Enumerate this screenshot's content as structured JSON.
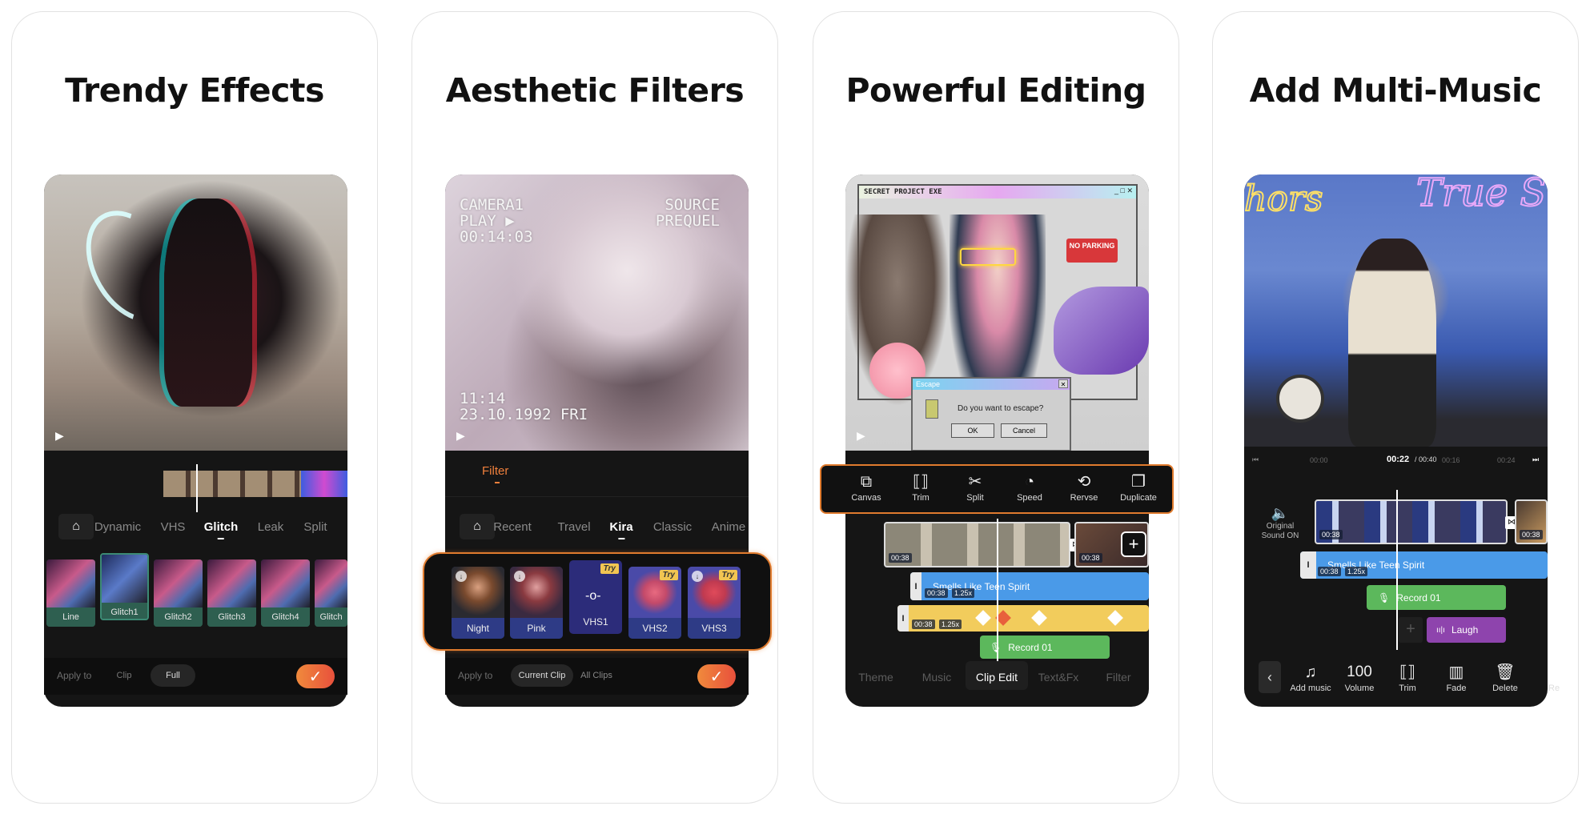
{
  "accent_color": "#f0803c",
  "panels": [
    {
      "title": "Trendy Effects",
      "timeline_tabs": [
        "Dynamic",
        "VHS",
        "Glitch",
        "Leak",
        "Split"
      ],
      "active_tab": "Glitch",
      "effects": [
        "Line",
        "Glitch1",
        "Glitch2",
        "Glitch3",
        "Glitch4",
        "Glitch"
      ],
      "selected_effect": "Glitch1",
      "apply_to_label": "Apply to",
      "apply_options": [
        "Clip",
        "Full"
      ],
      "apply_selected": "Full",
      "confirm_icon": "checkmark-icon"
    },
    {
      "title": "Aesthetic Filters",
      "overlay_top_left": [
        "CAMERA1",
        "PLAY ▶",
        "00:14:03"
      ],
      "overlay_top_right": [
        "SOURCE",
        "PREQUEL"
      ],
      "overlay_bottom_left": [
        "11:14",
        "23.10.1992 FRI"
      ],
      "section_label": "Filter",
      "filter_tabs": [
        "Recent",
        "Travel",
        "Kira",
        "Classic",
        "Anime"
      ],
      "active_tab": "Kira",
      "filters": [
        {
          "label": "Night",
          "badge": ""
        },
        {
          "label": "Pink",
          "badge": ""
        },
        {
          "label": "VHS1",
          "badge": "Try"
        },
        {
          "label": "VHS2",
          "badge": "Try"
        },
        {
          "label": "VHS3",
          "badge": "Try"
        }
      ],
      "selected_filter": "VHS1",
      "apply_to_label": "Apply to",
      "apply_options": [
        "Current Clip",
        "All Clips"
      ],
      "apply_selected": "Current Clip"
    },
    {
      "title": "Powerful Editing",
      "window_title": "SECRET PROJECT EXE",
      "sign_text": "NO PARKING",
      "dialog": {
        "title": "Escape",
        "message": "Do you want to escape?",
        "ok": "OK",
        "cancel": "Cancel"
      },
      "tools": [
        {
          "label": "Canvas",
          "icon": "canvas-icon"
        },
        {
          "label": "Trim",
          "icon": "trim-icon"
        },
        {
          "label": "Split",
          "icon": "scissors-icon"
        },
        {
          "label": "Speed",
          "icon": "speedometer-icon"
        },
        {
          "label": "Rervse",
          "icon": "reverse-icon"
        },
        {
          "label": "Duplicate",
          "icon": "duplicate-icon"
        }
      ],
      "clip_duration": "00:38",
      "music_track": {
        "name": "Smells Like Teen Spirit",
        "duration": "00:38",
        "speed": "1.25x"
      },
      "sticker_track": {
        "duration": "00:38",
        "speed": "1.25x"
      },
      "record_track": "Record 01",
      "bottom_tabs": [
        "Theme",
        "Music",
        "Clip Edit",
        "Text&Fx",
        "Filter"
      ],
      "active_bottom_tab": "Clip Edit"
    },
    {
      "title": "Add Multi-Music",
      "ruler": {
        "start": "00:00",
        "current": "00:22",
        "total": "/ 00:40",
        "mark1": "00:16",
        "mark2": "00:24"
      },
      "original_sound": "Original Sound ON",
      "clip_duration": "00:38",
      "music_track": {
        "name": "Smells Like Teen Spirit",
        "duration": "00:38",
        "speed": "1.25x"
      },
      "record_track": "Record 01",
      "sfx_track": "Laugh",
      "tools": [
        {
          "label": "Add music",
          "icon": "add-music-icon",
          "value": ""
        },
        {
          "label": "Volume",
          "icon": "",
          "value": "100"
        },
        {
          "label": "Trim",
          "icon": "trim-icon",
          "value": ""
        },
        {
          "label": "Fade",
          "icon": "fade-icon",
          "value": ""
        },
        {
          "label": "Delete",
          "icon": "trash-icon",
          "value": ""
        },
        {
          "label": "Re",
          "icon": "",
          "value": ""
        }
      ]
    }
  ]
}
